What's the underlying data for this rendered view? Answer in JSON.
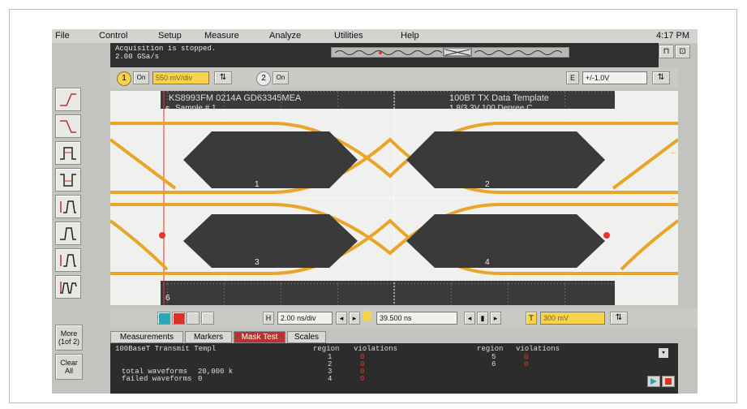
{
  "menubar": {
    "items": [
      "File",
      "Control",
      "Setup",
      "Measure",
      "Analyze",
      "Utilities",
      "Help"
    ],
    "clock": "4:17 PM"
  },
  "status": {
    "line1": "Acquisition is stopped.",
    "line2": "2.00 GSa/s"
  },
  "channels": {
    "ch1_number": "1",
    "ch1_on": "On",
    "ch1_scale": "550 mV/div",
    "ch2_number": "2",
    "ch2_on": "On",
    "trigger_label": "E",
    "trigger_value": "+/-1.0V"
  },
  "scope": {
    "header_left": "KS8993FM 0214A GD63345MEA",
    "header_sub": "Sample # 1",
    "header_right": "100BT TX Data Template",
    "header_right_sub": "1.8/3.3V 100 Degree C",
    "region_top": "5",
    "region_bottom": "6",
    "region_labels": [
      "1",
      "2",
      "3",
      "4"
    ],
    "colors": {
      "trace": "#e9a21e",
      "mask": "#3a3a3a",
      "grid": "#ffffff",
      "marker": "#e8352a"
    }
  },
  "timebase": {
    "h_label": "H",
    "scale": "2.00 ns/div",
    "delay": "39.500 ns",
    "t_label": "T",
    "t_value": "300 mV"
  },
  "sidebar": {
    "more_label": "More",
    "more_sub": "(1of 2)",
    "clear_label": "Clear",
    "clear_sub": "All"
  },
  "tabs": [
    "Measurements",
    "Markers",
    "Mask Test",
    "Scales"
  ],
  "active_tab": "Mask Test",
  "mask_test": {
    "template_name": "100BaseT Transmit Templ",
    "col_region": "region",
    "col_violations": "violations",
    "left_regions": [
      "1",
      "2",
      "3",
      "4"
    ],
    "left_violations": [
      "0",
      "0",
      "0",
      "0"
    ],
    "right_regions": [
      "5",
      "6"
    ],
    "right_violations": [
      "0",
      "0"
    ],
    "total_label": "total waveforms",
    "total_value": "20,000 k",
    "failed_label": "failed waveforms",
    "failed_value": "0"
  }
}
